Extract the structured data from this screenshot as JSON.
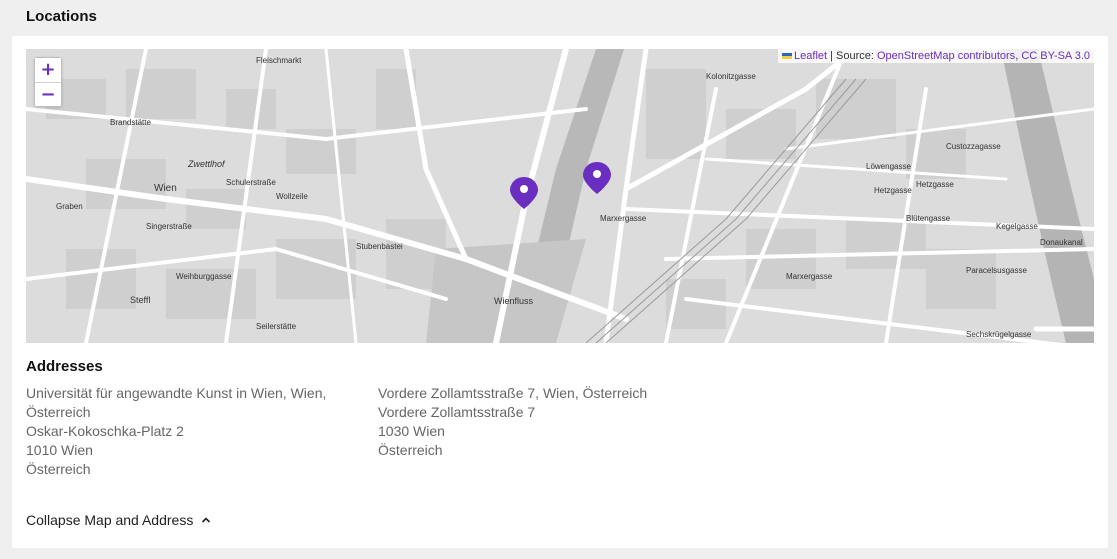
{
  "section": {
    "title": "Locations"
  },
  "map": {
    "zoom_in": "+",
    "zoom_out": "−",
    "attribution": {
      "leaflet": "Leaflet",
      "separator": " | Source: ",
      "osm": "OpenStreetMap contributors",
      "sep2": ", ",
      "license": "CC BY-SA 3.0"
    },
    "marker_color": "#6a2fc0",
    "labels": {
      "wien": "Wien",
      "zwettlhof": "Zwettlhof",
      "wienfluss": "Wienfluss",
      "steffl": "Steffl",
      "graben": "Graben",
      "donaukanal": "Donaukanal",
      "hetzgasse1": "Hetzgasse",
      "hetzgasse2": "Hetzgasse",
      "marxergasse": "Marxergasse",
      "kegelgasse": "Kegelgasse",
      "singerstrasse": "Singerstraße",
      "schulerstrasse": "Schulerstraße",
      "wollzeile": "Wollzeile",
      "blutengasse": "Blütengasse",
      "marxergasse2": "Marxergasse",
      "paracelsusgasse": "Paracelsusgasse",
      "kolonitzgasse": "Kolonitzgasse",
      "fleischmarkt": "Fleischmarkt",
      "brandstatte": "Brandstätte",
      "weihburggasse": "Weihburggasse",
      "seilerstatte": "Seilerstätte",
      "stubenbastei": "Stubenbastei",
      "lowengasse": "Löwengasse",
      "custozzagasse": "Custozzagasse",
      "sechskrugelgasse": "Sechskrügelgasse"
    }
  },
  "addresses": {
    "title": "Addresses",
    "items": [
      {
        "lines": [
          "Universität für angewandte Kunst in Wien, Wien, Österreich",
          "Oskar-Kokoschka-Platz 2",
          "1010 Wien",
          "Österreich"
        ]
      },
      {
        "lines": [
          "Vordere Zollamtsstraße 7, Wien, Österreich",
          "Vordere Zollamtsstraße 7",
          "1030 Wien",
          "Österreich"
        ]
      }
    ]
  },
  "collapse": {
    "label": "Collapse Map and Address"
  }
}
